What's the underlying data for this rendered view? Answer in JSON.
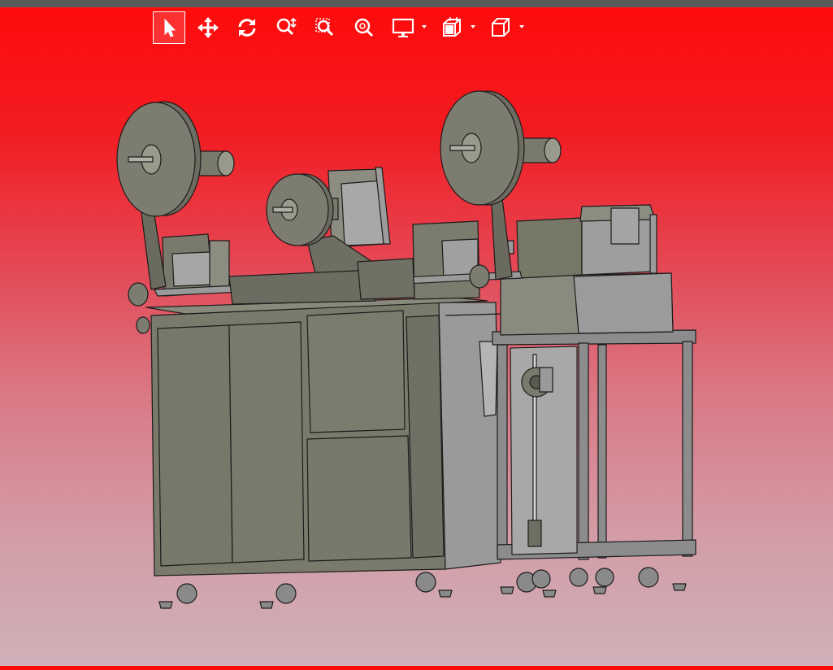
{
  "toolbar": {
    "tools": [
      {
        "id": "select",
        "icon": "cursor-arrow-icon",
        "active": true
      },
      {
        "id": "pan",
        "icon": "move-arrows-icon",
        "active": false
      },
      {
        "id": "rotate",
        "icon": "rotate-icon",
        "active": false
      },
      {
        "id": "zoom",
        "icon": "zoom-icon",
        "active": false
      },
      {
        "id": "zoom-window",
        "icon": "zoom-window-icon",
        "active": false
      },
      {
        "id": "zoom-fit",
        "icon": "zoom-fit-icon",
        "active": false
      },
      {
        "id": "display-mode",
        "icon": "monitor-icon",
        "active": false,
        "dropdown": true
      },
      {
        "id": "section-view",
        "icon": "section-cube-icon",
        "active": false,
        "dropdown": true
      },
      {
        "id": "view-orientation",
        "icon": "cube-icon",
        "active": false,
        "dropdown": true
      }
    ]
  },
  "colors": {
    "accent_topbar": "#5a5a5a",
    "background_top": "#ff0a0a",
    "background_bottom": "#cfb0b8",
    "model_face": "#7a7a6c",
    "model_edge": "#1c1c1c",
    "model_light": "#9c9c9c"
  },
  "viewport": {
    "model": "cad-assembly-machine"
  }
}
